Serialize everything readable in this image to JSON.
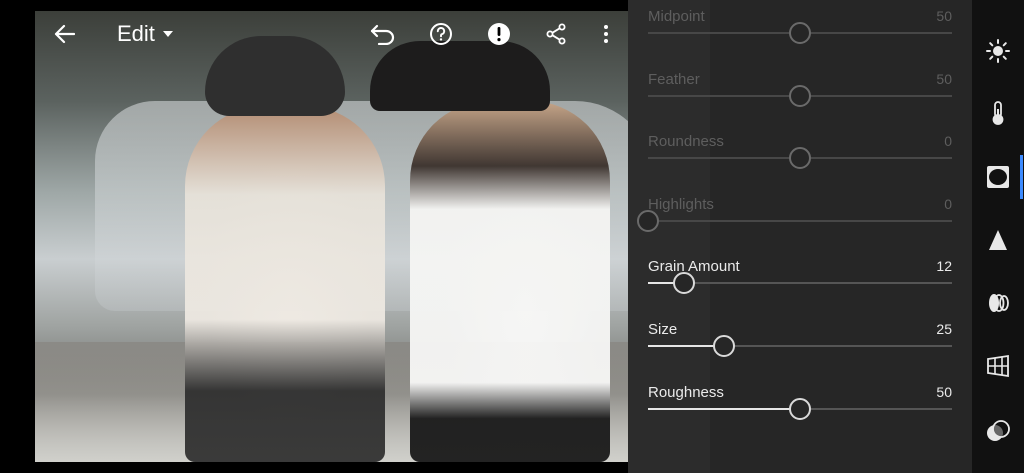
{
  "topbar": {
    "menu_label": "Edit",
    "icons": [
      "back-arrow-icon",
      "undo-icon",
      "help-icon",
      "alert-icon",
      "share-icon",
      "more-icon"
    ]
  },
  "panel": {
    "sliders": [
      {
        "label": "Midpoint",
        "value": "50",
        "level": 0.5,
        "state": "dim"
      },
      {
        "label": "Feather",
        "value": "50",
        "level": 0.5,
        "state": "dim"
      },
      {
        "label": "Roundness",
        "value": "0",
        "level": 0.5,
        "state": "dim"
      },
      {
        "label": "Highlights",
        "value": "0",
        "level": 0.0,
        "state": "dim"
      },
      {
        "label": "Grain Amount",
        "value": "12",
        "level": 0.12,
        "state": "active"
      },
      {
        "label": "Size",
        "value": "25",
        "level": 0.25,
        "state": "active"
      },
      {
        "label": "Roughness",
        "value": "50",
        "level": 0.5,
        "state": "active"
      }
    ]
  },
  "rail": {
    "tools": [
      "light-icon",
      "color-temperature-icon",
      "effects-vignette-icon",
      "detail-icon",
      "optics-icon",
      "geometry-icon",
      "presets-icon"
    ],
    "active_tool": "effects-vignette-icon",
    "accent_color": "#3d8bff"
  }
}
